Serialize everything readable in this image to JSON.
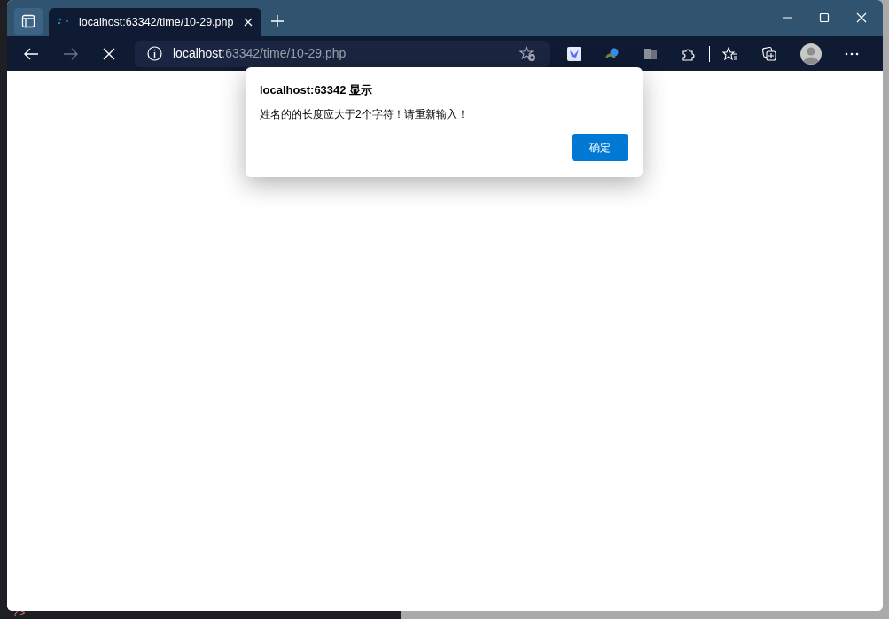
{
  "browser": {
    "tab": {
      "title": "localhost:63342/time/10-29.php",
      "selected": true
    },
    "address_bar": {
      "host": "localhost",
      "path": ":63342/time/10-29.php"
    },
    "loading": true
  },
  "dialog": {
    "title": "localhost:63342 显示",
    "message": "姓名的的长度应大于2个字符！请重新输入！",
    "buttons": [
      {
        "label": "确定",
        "primary": true
      }
    ]
  },
  "background": {
    "code_fragment": "?>"
  }
}
